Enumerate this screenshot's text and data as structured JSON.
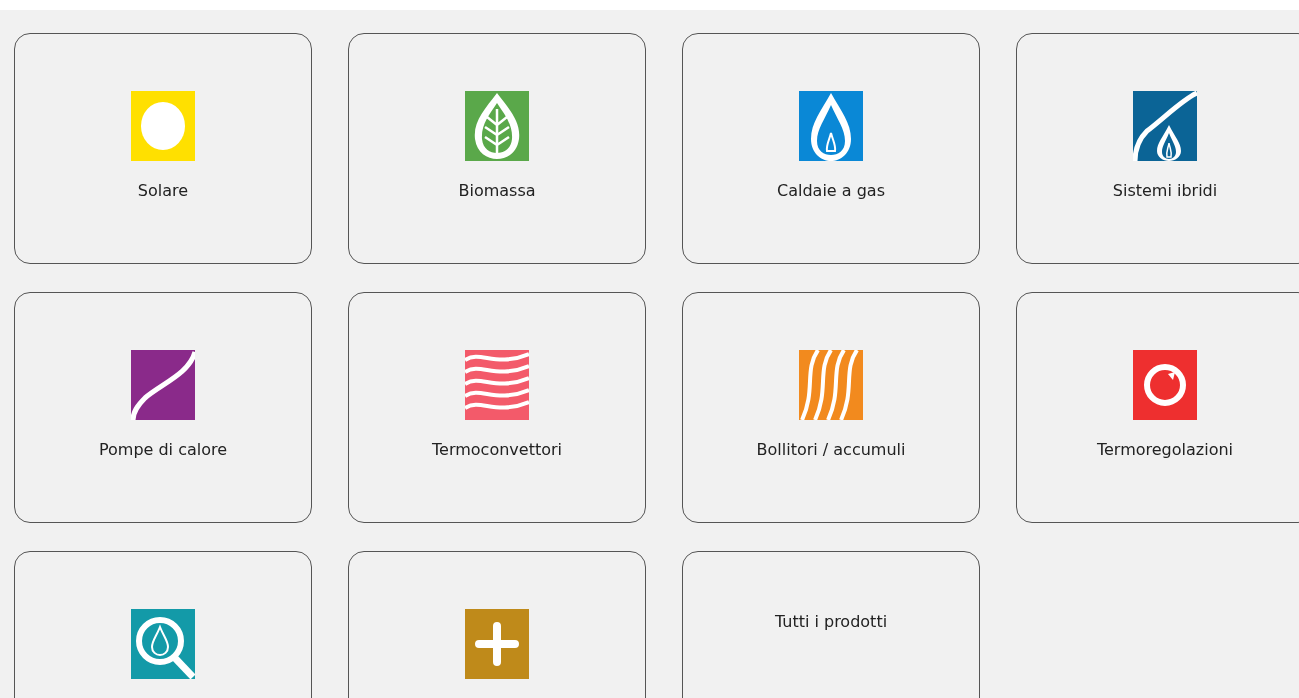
{
  "categories": [
    {
      "kind": "sun",
      "label": "Solare"
    },
    {
      "kind": "leaf",
      "label": "Biomassa"
    },
    {
      "kind": "flame",
      "label": "Caldaie a gas"
    },
    {
      "kind": "hybrid",
      "label": "Sistemi ibridi"
    },
    {
      "kind": "curve",
      "label": "Pompe di calore"
    },
    {
      "kind": "waves",
      "label": "Termoconvettori"
    },
    {
      "kind": "coils",
      "label": "Bollitori / accumuli"
    },
    {
      "kind": "dial",
      "label": "Termoregolazioni"
    },
    {
      "kind": "drop"
    },
    {
      "kind": "plus"
    },
    {
      "kind": "text",
      "label": "Tutti i prodotti"
    }
  ]
}
